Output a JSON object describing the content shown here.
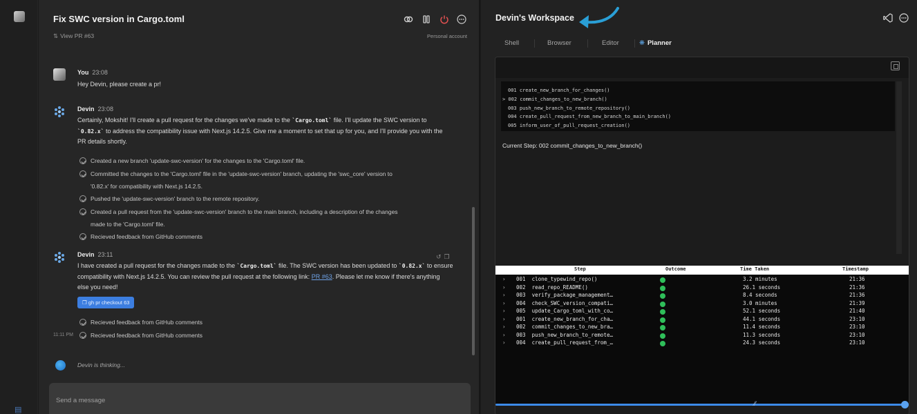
{
  "chat": {
    "title": "Fix SWC version in Cargo.toml",
    "view_pr": "View PR #63",
    "account": "Personal account",
    "messages": {
      "you": {
        "sender": "You",
        "time": "23:08",
        "text": "Hey Devin, please create a pr!"
      },
      "devin1": {
        "sender": "Devin",
        "time": "23:08",
        "line1a": "Certainly, Mokshit! I'll create a pull request for the changes we've made to the ",
        "line1code": "`Cargo.toml`",
        "line1b": " file. I'll update the SWC version to",
        "line2code": "`0.82.x`",
        "line2b": " to address the compatibility issue with Next.js 14.2.5. Give me a moment to set that up for you, and I'll provide you with the",
        "line3": "PR details shortly.",
        "steps": [
          "Created a new branch 'update-swc-version' for the changes to the 'Cargo.toml' file.",
          "Committed the changes to the 'Cargo.toml' file in the 'update-swc-version' branch, updating the 'swc_core' version to",
          "'0.82.x' for compatibility with Next.js 14.2.5.",
          "Pushed the 'update-swc-version' branch to the remote repository.",
          "Created a pull request from the 'update-swc-version' branch to the main branch, including a description of the changes",
          "made to the 'Cargo.toml' file.",
          "Recieved feedback from GitHub comments"
        ]
      },
      "devin2": {
        "sender": "Devin",
        "time": "23:11",
        "line1a": "I have created a pull request for the changes made to the ",
        "line1code": "`Cargo.toml`",
        "line1b": " file. The SWC version has been updated to ",
        "line1code2": "`0.82.x`",
        "line1c": " to ensure",
        "line2a": "compatibility with Next.js 14.2.5. You can review the pull request at the following link: ",
        "line2link": "PR #63",
        "line2b": ". Please let me know if there's anything",
        "line2blur": "      ",
        "line3": "else you need!",
        "command": "gh pr checkout 63",
        "steps": [
          "Recieved feedback from GitHub comments",
          "Recieved feedback from GitHub comments"
        ],
        "side_time": "11:11 PM"
      }
    },
    "thinking": "Devin is thinking...",
    "input_placeholder": "Send a message"
  },
  "workspace": {
    "title": "Devin's Workspace",
    "tabs": [
      "Shell",
      "Browser",
      "Editor",
      "Planner"
    ],
    "active_tab": "Planner",
    "plan": [
      "001 create_new_branch_for_changes()",
      "> 002 commit_changes_to_new_branch()",
      "003 push_new_branch_to_remote_repository()",
      "004 create_pull_request_from_new_branch_to_main_branch()",
      "005 inform_user_of_pull_request_creation()"
    ],
    "current_step": "Current Step: 002 commit_changes_to_new_branch()",
    "table": {
      "headers": [
        "Step",
        "Outcome",
        "Time Taken",
        "Timestamp"
      ],
      "rows": [
        {
          "step": "001  clone_typewind_repo()",
          "time": "3.2 minutes",
          "ts": "21:36"
        },
        {
          "step": "002  read_repo_README()",
          "time": "26.1 seconds",
          "ts": "21:36"
        },
        {
          "step": "003  verify_package_management…",
          "time": "8.4 seconds",
          "ts": "21:36"
        },
        {
          "step": "004  check_SWC_version_compati…",
          "time": "3.0 minutes",
          "ts": "21:39"
        },
        {
          "step": "005  update_Cargo_toml_with_co…",
          "time": "52.1 seconds",
          "ts": "21:40"
        },
        {
          "step": "001  create_new_branch_for_cha…",
          "time": "44.1 seconds",
          "ts": "23:10"
        },
        {
          "step": "002  commit_changes_to_new_bra…",
          "time": "11.4 seconds",
          "ts": "23:10"
        },
        {
          "step": "003  push_new_branch_to_remote…",
          "time": "11.3 seconds",
          "ts": "23:10"
        },
        {
          "step": "004  create_pull_request_from_…",
          "time": "24.3 seconds",
          "ts": "23:10"
        }
      ]
    },
    "progress": 1.0
  },
  "colors": {
    "accent": "#3c7ee0",
    "success": "#2fbf5a",
    "danger": "#e05050"
  }
}
